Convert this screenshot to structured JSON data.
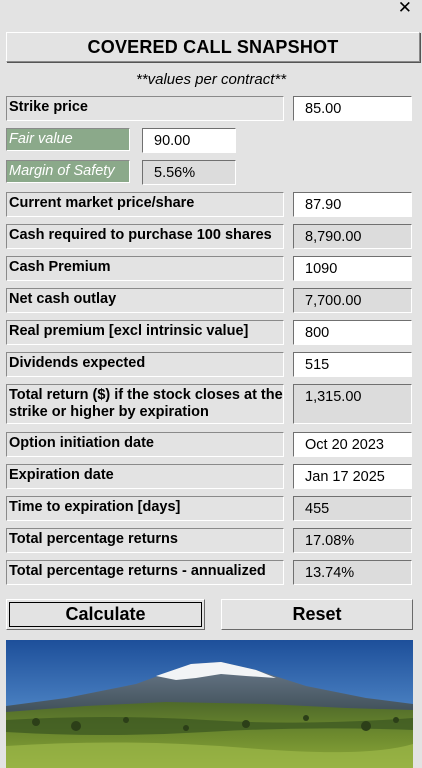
{
  "window": {
    "close_glyph": "✕"
  },
  "title": "COVERED CALL SNAPSHOT",
  "subtitle": "**values per contract**",
  "fields": {
    "strike_price": {
      "label": "Strike price",
      "value": "85.00"
    },
    "fair_value": {
      "label": "Fair value",
      "value": "90.00"
    },
    "margin_of_safety": {
      "label": "Margin of Safety",
      "value": "5.56%"
    },
    "current_price": {
      "label": "Current market price/share",
      "value": "87.90"
    },
    "cash_required": {
      "label": "Cash required to purchase 100 shares",
      "value": "8,790.00"
    },
    "cash_premium": {
      "label": "Cash Premium",
      "value": "1090"
    },
    "net_outlay": {
      "label": "Net cash outlay",
      "value": "7,700.00"
    },
    "real_premium": {
      "label": "Real premium [excl intrinsic value]",
      "value": "800"
    },
    "dividends": {
      "label": "Dividends expected",
      "value": "515"
    },
    "total_return": {
      "label": "Total return ($) if the stock closes at the strike or higher by expiration",
      "value": "1,315.00"
    },
    "initiation_date": {
      "label": "Option initiation date",
      "value": "Oct 20 2023"
    },
    "expiration_date": {
      "label": "Expiration date",
      "value": "Jan 17 2025"
    },
    "time_to_expiration": {
      "label": "Time to expiration [days]",
      "value": "455"
    },
    "total_pct": {
      "label": "Total percentage returns",
      "value": "17.08%"
    },
    "total_pct_annual": {
      "label": "Total percentage returns - annualized",
      "value": "13.74%"
    }
  },
  "buttons": {
    "calculate": "Calculate",
    "reset": "Reset"
  },
  "colors": {
    "label_green": "#8ba98a",
    "background": "#e3e3e3"
  },
  "image": {
    "icon": "mountain-landscape-photo"
  }
}
